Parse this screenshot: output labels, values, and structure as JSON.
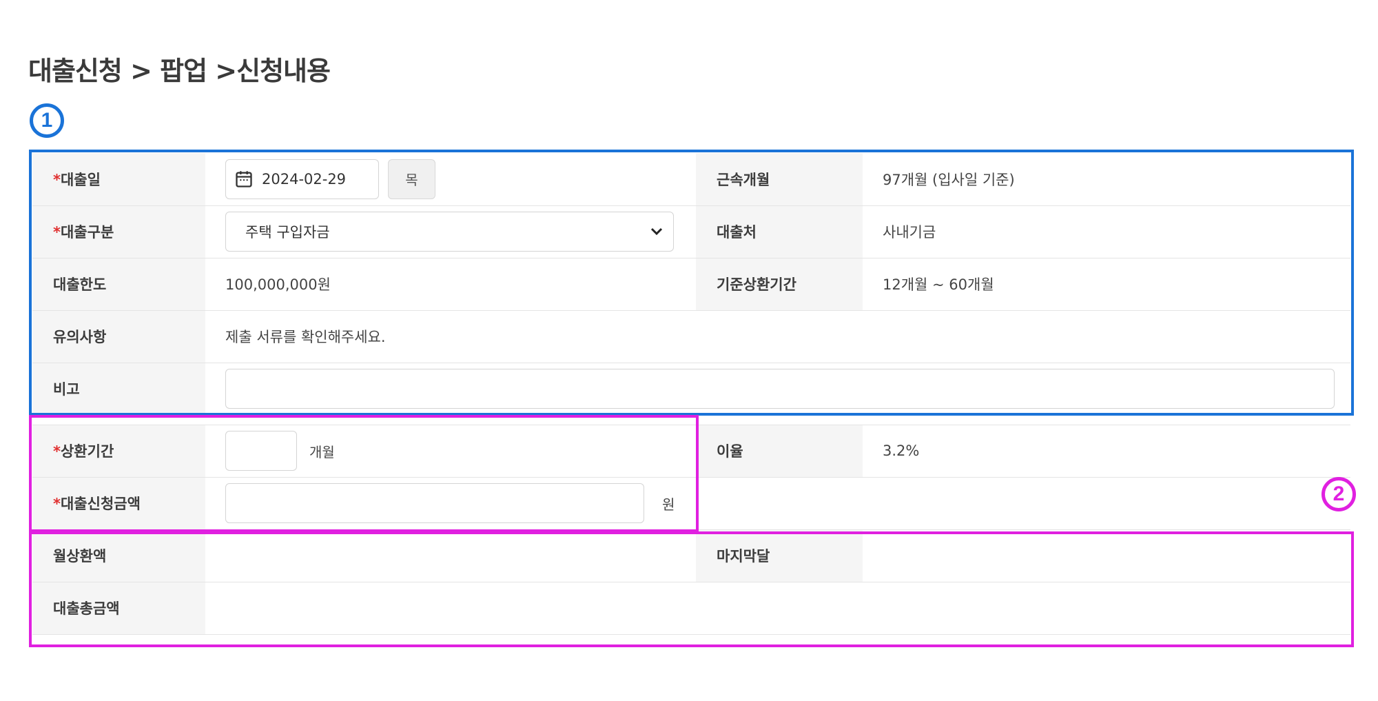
{
  "header": {
    "title": "대출신청 > 팝업 >신청내용",
    "markers": {
      "one": "1",
      "two": "2"
    }
  },
  "colors": {
    "annotation_blue": "#1a73d8",
    "annotation_pink": "#e020e0",
    "required_mark": "#e03030",
    "header_cell_bg": "#f5f5f5"
  },
  "form": {
    "required_mark": "*",
    "loan_date": {
      "label": "대출일",
      "value": "2024-02-29",
      "weekday": "목",
      "icon": "calendar-icon"
    },
    "tenure": {
      "label": "근속개월",
      "value": "97개월 (입사일 기준)"
    },
    "loan_type": {
      "label": "대출구분",
      "selected": "주택 구입자금",
      "icon": "chevron-down-icon"
    },
    "lender": {
      "label": "대출처",
      "value": "사내기금"
    },
    "loan_limit": {
      "label": "대출한도",
      "value": "100,000,000원"
    },
    "standard_repay_period": {
      "label": "기준상환기간",
      "value": "12개월 ~ 60개월"
    },
    "notice": {
      "label": "유의사항",
      "value": "제출 서류를 확인해주세요."
    },
    "remark": {
      "label": "비고",
      "value": ""
    },
    "repay_period": {
      "label": "상환기간",
      "value": "",
      "unit": "개월"
    },
    "interest_rate": {
      "label": "이율",
      "value": "3.2%"
    },
    "request_amount": {
      "label": "대출신청금액",
      "value": "",
      "unit": "원"
    },
    "monthly_payment": {
      "label": "월상환액",
      "value": ""
    },
    "last_month": {
      "label": "마지막달",
      "value": ""
    },
    "total_amount": {
      "label": "대출총금액",
      "value": ""
    }
  }
}
